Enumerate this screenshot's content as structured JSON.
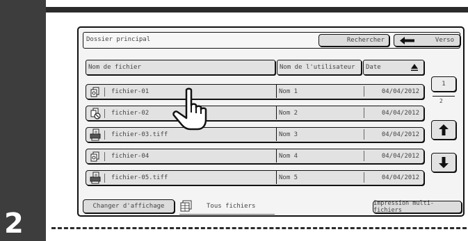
{
  "step": {
    "number": "2"
  },
  "header": {
    "title": "Dossier principal",
    "search_label": "Rechercher",
    "back_label": "Verso"
  },
  "columns": {
    "file_name": "Nom de fichier",
    "user_name": "Nom de l'utilisateur",
    "date": "Date"
  },
  "rows": [
    {
      "icon": "copy-file-icon",
      "name": "fichier-01",
      "user": "Nom 1",
      "date": "04/04/2012"
    },
    {
      "icon": "copy-forbidden-icon",
      "name": "fichier-02",
      "user": "Nom 2",
      "date": "04/04/2012"
    },
    {
      "icon": "printer-file-icon",
      "name": "fichier-03.tiff",
      "user": "Nom 3",
      "date": "04/04/2012"
    },
    {
      "icon": "copy-file-icon",
      "name": "fichier-04",
      "user": "Nom 4",
      "date": "04/04/2012"
    },
    {
      "icon": "printer-file-icon",
      "name": "fichier-05.tiff",
      "user": "Nom 5",
      "date": "04/04/2012"
    }
  ],
  "pagination": {
    "current": "1",
    "total": "2"
  },
  "footer": {
    "change_view_label": "Changer d'affichage",
    "filter_label": "Tous fichiers",
    "multi_print_label": "Impression multi-fichiers"
  },
  "colors": {
    "sidebar": "#3d3d3d",
    "button_fill": "#e2e2e2",
    "outline": "#111111"
  }
}
